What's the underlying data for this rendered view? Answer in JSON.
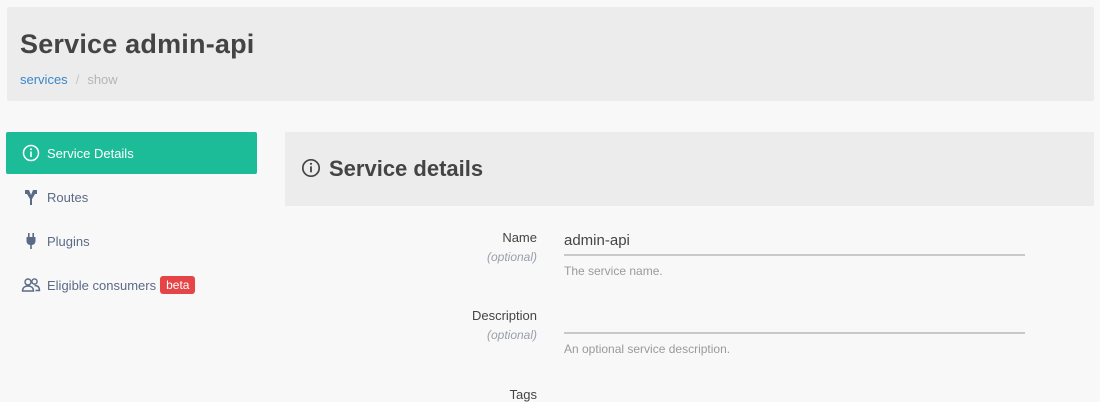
{
  "header": {
    "title": "Service admin-api",
    "breadcrumb": {
      "link": "services",
      "separator": "/",
      "current": "show"
    }
  },
  "sidebar": {
    "items": [
      {
        "label": "Service Details",
        "icon": "info-circle-icon",
        "active": true
      },
      {
        "label": "Routes",
        "icon": "routes-icon",
        "active": false
      },
      {
        "label": "Plugins",
        "icon": "plug-icon",
        "active": false
      },
      {
        "label": "Eligible consumers",
        "icon": "users-icon",
        "active": false,
        "badge": "beta"
      }
    ]
  },
  "panel": {
    "title": "Service details",
    "icon": "info-circle-icon"
  },
  "form": {
    "name": {
      "label": "Name",
      "optional": "(optional)",
      "value": "admin-api",
      "placeholder": "",
      "help": "The service name."
    },
    "description": {
      "label": "Description",
      "optional": "(optional)",
      "value": "",
      "placeholder": "",
      "help": "An optional service description."
    },
    "tags": {
      "label": "Tags"
    }
  },
  "colors": {
    "accent": "#1dbc98",
    "link": "#3a87c9",
    "badge": "#e64548"
  }
}
